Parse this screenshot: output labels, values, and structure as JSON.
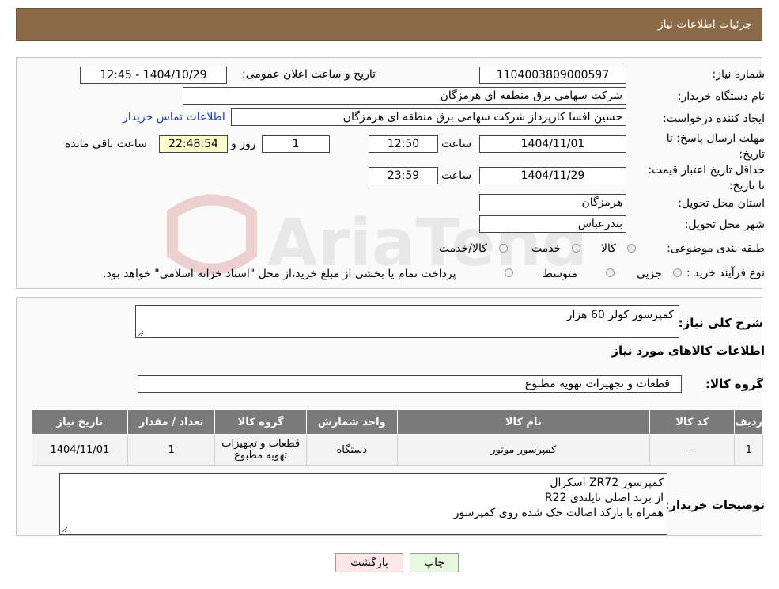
{
  "header": {
    "title": "جزئیات اطلاعات نیاز"
  },
  "fields": {
    "need_number_label": "شماره نیاز:",
    "need_number": "1104003809000597",
    "announce_label": "تاریخ و ساعت اعلان عمومی:",
    "announce_value": "1404/10/29 - 12:45",
    "buyer_org_label": "نام دستگاه خریدار:",
    "buyer_org": "شرکت سهامی برق منطقه ای هرمزگان",
    "requester_label": "ایجاد کننده درخواست:",
    "requester": "حسین افسا کارپرداز شرکت سهامی برق منطقه ای هرمزگان",
    "contact_link": "اطلاعات تماس خریدار",
    "deadline_label": "مهلت ارسال پاسخ: تا تاریخ:",
    "deadline_date": "1404/11/01",
    "time_label": "ساعت",
    "deadline_time": "12:50",
    "days_value": "1",
    "days_label": "روز و",
    "remaining_value": "22:48:54",
    "remaining_label": "ساعت باقی مانده",
    "validity_label": "حداقل تاریخ اعتبار قیمت: تا تاریخ:",
    "validity_date": "1404/11/29",
    "validity_time": "23:59",
    "province_label": "استان محل تحویل:",
    "province": "هرمزگان",
    "city_label": "شهر محل تحویل:",
    "city": "بندرعباس",
    "category_label": "طبقه بندی موضوعی:",
    "category_options": [
      "کالا",
      "خدمت",
      "کالا/خدمت"
    ],
    "process_label": "نوع فرآیند خرید :",
    "process_options": [
      "جزیی",
      "متوسط"
    ],
    "payment_note": "پرداخت تمام یا بخشی از مبلغ خرید،از محل \"اسناد خزانه اسلامی\" خواهد بود."
  },
  "summary": {
    "desc_label": "شرح کلی نیاز:",
    "desc_value": "کمپرسور کولر 60 هزار",
    "goods_info_title": "اطلاعات کالاهای مورد نیاز",
    "group_label": "گروه کالا:",
    "group_value": "قطعات و تجهیزات تهویه مطبوع"
  },
  "table": {
    "headers": [
      "ردیف",
      "کد کالا",
      "نام کالا",
      "واحد شمارش",
      "گروه کالا",
      "تعداد / مقدار",
      "تاریخ نیاز"
    ],
    "rows": [
      [
        "1",
        "--",
        "کمپرسور موتور",
        "دستگاه",
        "قطعات و تجهیزات تهویه مطبوع",
        "1",
        "1404/11/01"
      ]
    ]
  },
  "buyer_notes": {
    "label": "توضیحات خریدار:",
    "lines": [
      "کمپرسور ZR72 اسکرال",
      "از برند اصلی تایلندی R22",
      "همراه با بارکد اصالت حک شده روی کمپرسور"
    ]
  },
  "buttons": {
    "print": "چاپ",
    "back": "بازگشت"
  },
  "watermark": {
    "text": "AriaTender.neT"
  },
  "colors": {
    "header": "#8b6b47",
    "print_btn": "#e8f7e0",
    "back_btn": "#fde6e6",
    "link": "#1a3fb0"
  }
}
